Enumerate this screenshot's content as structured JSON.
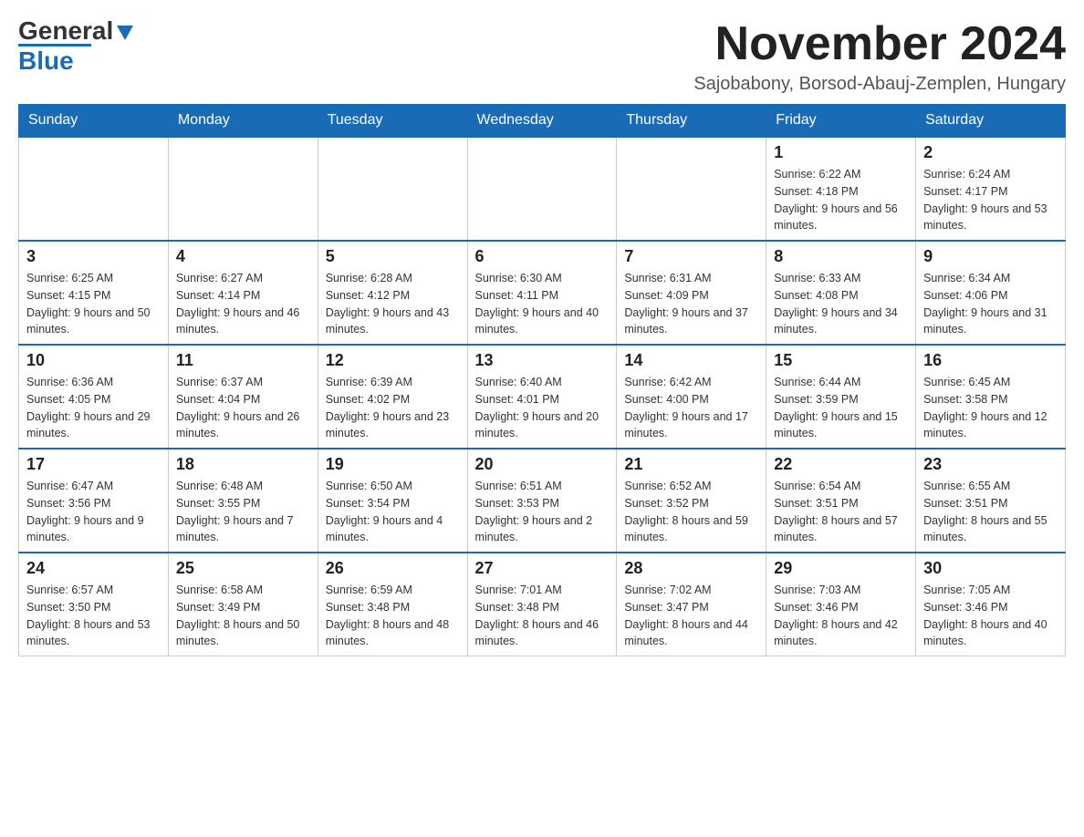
{
  "logo": {
    "text_general": "General",
    "text_blue": "Blue"
  },
  "header": {
    "month_title": "November 2024",
    "subtitle": "Sajobabony, Borsod-Abauj-Zemplen, Hungary"
  },
  "weekdays": [
    "Sunday",
    "Monday",
    "Tuesday",
    "Wednesday",
    "Thursday",
    "Friday",
    "Saturday"
  ],
  "weeks": [
    [
      {
        "day": "",
        "sunrise": "",
        "sunset": "",
        "daylight": ""
      },
      {
        "day": "",
        "sunrise": "",
        "sunset": "",
        "daylight": ""
      },
      {
        "day": "",
        "sunrise": "",
        "sunset": "",
        "daylight": ""
      },
      {
        "day": "",
        "sunrise": "",
        "sunset": "",
        "daylight": ""
      },
      {
        "day": "",
        "sunrise": "",
        "sunset": "",
        "daylight": ""
      },
      {
        "day": "1",
        "sunrise": "Sunrise: 6:22 AM",
        "sunset": "Sunset: 4:18 PM",
        "daylight": "Daylight: 9 hours and 56 minutes."
      },
      {
        "day": "2",
        "sunrise": "Sunrise: 6:24 AM",
        "sunset": "Sunset: 4:17 PM",
        "daylight": "Daylight: 9 hours and 53 minutes."
      }
    ],
    [
      {
        "day": "3",
        "sunrise": "Sunrise: 6:25 AM",
        "sunset": "Sunset: 4:15 PM",
        "daylight": "Daylight: 9 hours and 50 minutes."
      },
      {
        "day": "4",
        "sunrise": "Sunrise: 6:27 AM",
        "sunset": "Sunset: 4:14 PM",
        "daylight": "Daylight: 9 hours and 46 minutes."
      },
      {
        "day": "5",
        "sunrise": "Sunrise: 6:28 AM",
        "sunset": "Sunset: 4:12 PM",
        "daylight": "Daylight: 9 hours and 43 minutes."
      },
      {
        "day": "6",
        "sunrise": "Sunrise: 6:30 AM",
        "sunset": "Sunset: 4:11 PM",
        "daylight": "Daylight: 9 hours and 40 minutes."
      },
      {
        "day": "7",
        "sunrise": "Sunrise: 6:31 AM",
        "sunset": "Sunset: 4:09 PM",
        "daylight": "Daylight: 9 hours and 37 minutes."
      },
      {
        "day": "8",
        "sunrise": "Sunrise: 6:33 AM",
        "sunset": "Sunset: 4:08 PM",
        "daylight": "Daylight: 9 hours and 34 minutes."
      },
      {
        "day": "9",
        "sunrise": "Sunrise: 6:34 AM",
        "sunset": "Sunset: 4:06 PM",
        "daylight": "Daylight: 9 hours and 31 minutes."
      }
    ],
    [
      {
        "day": "10",
        "sunrise": "Sunrise: 6:36 AM",
        "sunset": "Sunset: 4:05 PM",
        "daylight": "Daylight: 9 hours and 29 minutes."
      },
      {
        "day": "11",
        "sunrise": "Sunrise: 6:37 AM",
        "sunset": "Sunset: 4:04 PM",
        "daylight": "Daylight: 9 hours and 26 minutes."
      },
      {
        "day": "12",
        "sunrise": "Sunrise: 6:39 AM",
        "sunset": "Sunset: 4:02 PM",
        "daylight": "Daylight: 9 hours and 23 minutes."
      },
      {
        "day": "13",
        "sunrise": "Sunrise: 6:40 AM",
        "sunset": "Sunset: 4:01 PM",
        "daylight": "Daylight: 9 hours and 20 minutes."
      },
      {
        "day": "14",
        "sunrise": "Sunrise: 6:42 AM",
        "sunset": "Sunset: 4:00 PM",
        "daylight": "Daylight: 9 hours and 17 minutes."
      },
      {
        "day": "15",
        "sunrise": "Sunrise: 6:44 AM",
        "sunset": "Sunset: 3:59 PM",
        "daylight": "Daylight: 9 hours and 15 minutes."
      },
      {
        "day": "16",
        "sunrise": "Sunrise: 6:45 AM",
        "sunset": "Sunset: 3:58 PM",
        "daylight": "Daylight: 9 hours and 12 minutes."
      }
    ],
    [
      {
        "day": "17",
        "sunrise": "Sunrise: 6:47 AM",
        "sunset": "Sunset: 3:56 PM",
        "daylight": "Daylight: 9 hours and 9 minutes."
      },
      {
        "day": "18",
        "sunrise": "Sunrise: 6:48 AM",
        "sunset": "Sunset: 3:55 PM",
        "daylight": "Daylight: 9 hours and 7 minutes."
      },
      {
        "day": "19",
        "sunrise": "Sunrise: 6:50 AM",
        "sunset": "Sunset: 3:54 PM",
        "daylight": "Daylight: 9 hours and 4 minutes."
      },
      {
        "day": "20",
        "sunrise": "Sunrise: 6:51 AM",
        "sunset": "Sunset: 3:53 PM",
        "daylight": "Daylight: 9 hours and 2 minutes."
      },
      {
        "day": "21",
        "sunrise": "Sunrise: 6:52 AM",
        "sunset": "Sunset: 3:52 PM",
        "daylight": "Daylight: 8 hours and 59 minutes."
      },
      {
        "day": "22",
        "sunrise": "Sunrise: 6:54 AM",
        "sunset": "Sunset: 3:51 PM",
        "daylight": "Daylight: 8 hours and 57 minutes."
      },
      {
        "day": "23",
        "sunrise": "Sunrise: 6:55 AM",
        "sunset": "Sunset: 3:51 PM",
        "daylight": "Daylight: 8 hours and 55 minutes."
      }
    ],
    [
      {
        "day": "24",
        "sunrise": "Sunrise: 6:57 AM",
        "sunset": "Sunset: 3:50 PM",
        "daylight": "Daylight: 8 hours and 53 minutes."
      },
      {
        "day": "25",
        "sunrise": "Sunrise: 6:58 AM",
        "sunset": "Sunset: 3:49 PM",
        "daylight": "Daylight: 8 hours and 50 minutes."
      },
      {
        "day": "26",
        "sunrise": "Sunrise: 6:59 AM",
        "sunset": "Sunset: 3:48 PM",
        "daylight": "Daylight: 8 hours and 48 minutes."
      },
      {
        "day": "27",
        "sunrise": "Sunrise: 7:01 AM",
        "sunset": "Sunset: 3:48 PM",
        "daylight": "Daylight: 8 hours and 46 minutes."
      },
      {
        "day": "28",
        "sunrise": "Sunrise: 7:02 AM",
        "sunset": "Sunset: 3:47 PM",
        "daylight": "Daylight: 8 hours and 44 minutes."
      },
      {
        "day": "29",
        "sunrise": "Sunrise: 7:03 AM",
        "sunset": "Sunset: 3:46 PM",
        "daylight": "Daylight: 8 hours and 42 minutes."
      },
      {
        "day": "30",
        "sunrise": "Sunrise: 7:05 AM",
        "sunset": "Sunset: 3:46 PM",
        "daylight": "Daylight: 8 hours and 40 minutes."
      }
    ]
  ]
}
